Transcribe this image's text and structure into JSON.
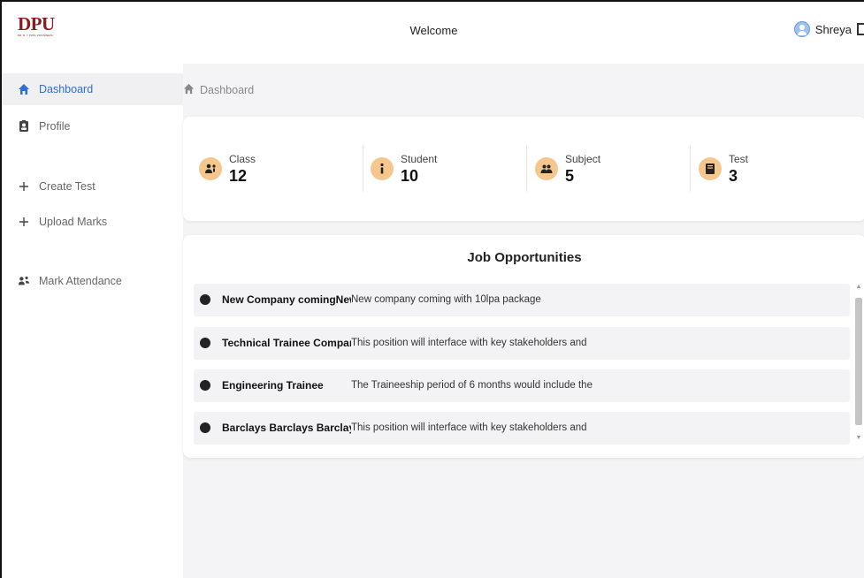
{
  "header": {
    "logo_text": "DPU",
    "logo_subtext": "DR. D. Y. PATIL VIDYAPEETH",
    "title": "Welcome",
    "user_name": "Shreya"
  },
  "sidebar": {
    "items": [
      {
        "label": "Dashboard",
        "icon": "home-icon"
      },
      {
        "label": "Profile",
        "icon": "id-badge-icon"
      },
      {
        "label": "Create Test",
        "icon": "plus-icon"
      },
      {
        "label": "Upload Marks",
        "icon": "plus-icon"
      },
      {
        "label": "Mark Attendance",
        "icon": "users-icon"
      }
    ],
    "active": "Dashboard"
  },
  "breadcrumb": {
    "label": "Dashboard"
  },
  "stats": [
    {
      "label": "Class",
      "value": "12",
      "icon": "teacher-icon"
    },
    {
      "label": "Student",
      "value": "10",
      "icon": "info-icon"
    },
    {
      "label": "Subject",
      "value": "5",
      "icon": "group-icon"
    },
    {
      "label": "Test",
      "value": "3",
      "icon": "book-icon"
    }
  ],
  "jobs": {
    "title": "Job Opportunities",
    "items": [
      {
        "name": "New Company comingNew",
        "desc": "New company coming with 10lpa package"
      },
      {
        "name": "Technical Trainee Company",
        "desc": "This position will interface with key stakeholders and"
      },
      {
        "name": "Engineering Trainee",
        "desc": "The Traineeship period of 6 months would include the"
      },
      {
        "name": "Barclays Barclays Barclays",
        "desc": "This position will interface with key stakeholders and"
      }
    ]
  },
  "colors": {
    "accent": "#2e6fd8",
    "brand": "#8b1a1a",
    "stat_icon_bg": "#f5c78e"
  }
}
